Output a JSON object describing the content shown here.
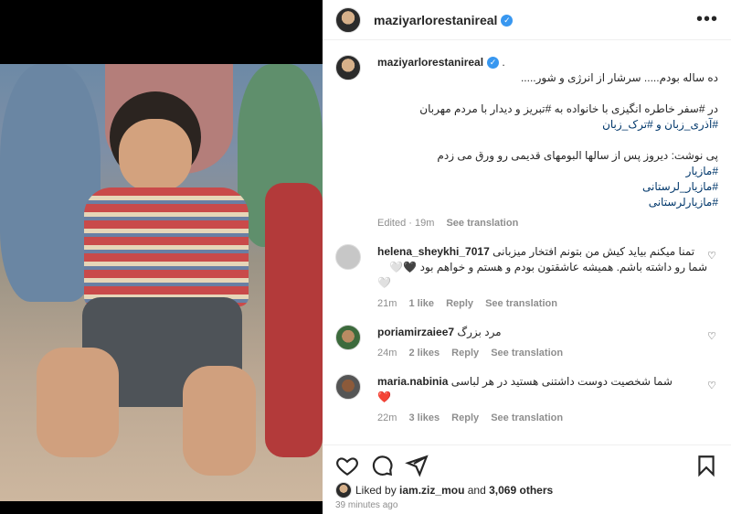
{
  "post": {
    "username": "maziyarlorestanireal",
    "more_label": "•••"
  },
  "caption": {
    "username": "maziyarlorestanireal",
    "dot": ".",
    "line1": "ده ساله بودم..... سرشار از انرژی و شور.....",
    "line2": "در #سفر خاطره انگیزی با خانواده به #تبریز و دیدار با مردم مهربان",
    "line3": "#آذری_زبان و #ترک_زبان",
    "line4": "پی نوشت: دیروز پس از سالها البومهای قدیمی رو ورق می زدم",
    "line5": "#مازیار",
    "line6": "#مازیار_لرستانی",
    "line7": "#مازیارلرستانی",
    "edited": "Edited · 19m",
    "see_translation": "See translation"
  },
  "comments": [
    {
      "username": "helena_sheykhi_7017",
      "text_line1": "تمنا میکنم بیاید کیش من بتونم افتخار میزبانی",
      "text_line2": "شما رو داشته باشم. همیشه عاشقتون بودم و هستم و خواهم بود 🖤🤍",
      "text_line3": "🤍",
      "time": "21m",
      "likes": "1 like",
      "reply": "Reply",
      "see_translation": "See translation"
    },
    {
      "username": "poriamirzaiee7",
      "text_line1": "مرد بزرگ",
      "time": "24m",
      "likes": "2 likes",
      "reply": "Reply",
      "see_translation": "See translation"
    },
    {
      "username": "maria.nabinia",
      "text_line1": "شما شخصیت دوست داشتنی هستید در هر لباسی",
      "text_line2": "❤️",
      "time": "22m",
      "likes": "3 likes",
      "reply": "Reply",
      "see_translation": "See translation"
    }
  ],
  "footer": {
    "liked_by_prefix": "Liked by",
    "liked_by_user": "iam.ziz_mou",
    "liked_by_and": "and",
    "others": "3,069 others",
    "time_ago": "39 minutes ago"
  },
  "icons": {
    "like": "heart-icon",
    "comment": "comment-icon",
    "share": "share-icon",
    "save": "bookmark-icon",
    "verified": "verified-badge-icon"
  }
}
